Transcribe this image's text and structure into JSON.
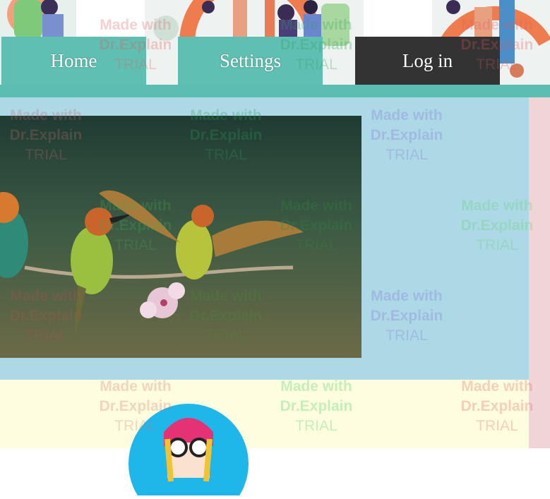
{
  "nav": {
    "home_label": "Home",
    "settings_label": "Settings",
    "login_label": "Log in"
  },
  "watermark": {
    "line1": "Made with",
    "line2": "Dr.Explain",
    "line3": "TRIAL"
  },
  "colors": {
    "nav_teal": "#60bfb3",
    "login_dark": "#333333",
    "section_blue": "#add8e6",
    "section_yellow": "#fffddf"
  },
  "images": {
    "hero": "people-illustration",
    "photo": "bee-eater-birds-on-branch",
    "avatar": "cartoon-girl-avatar"
  }
}
